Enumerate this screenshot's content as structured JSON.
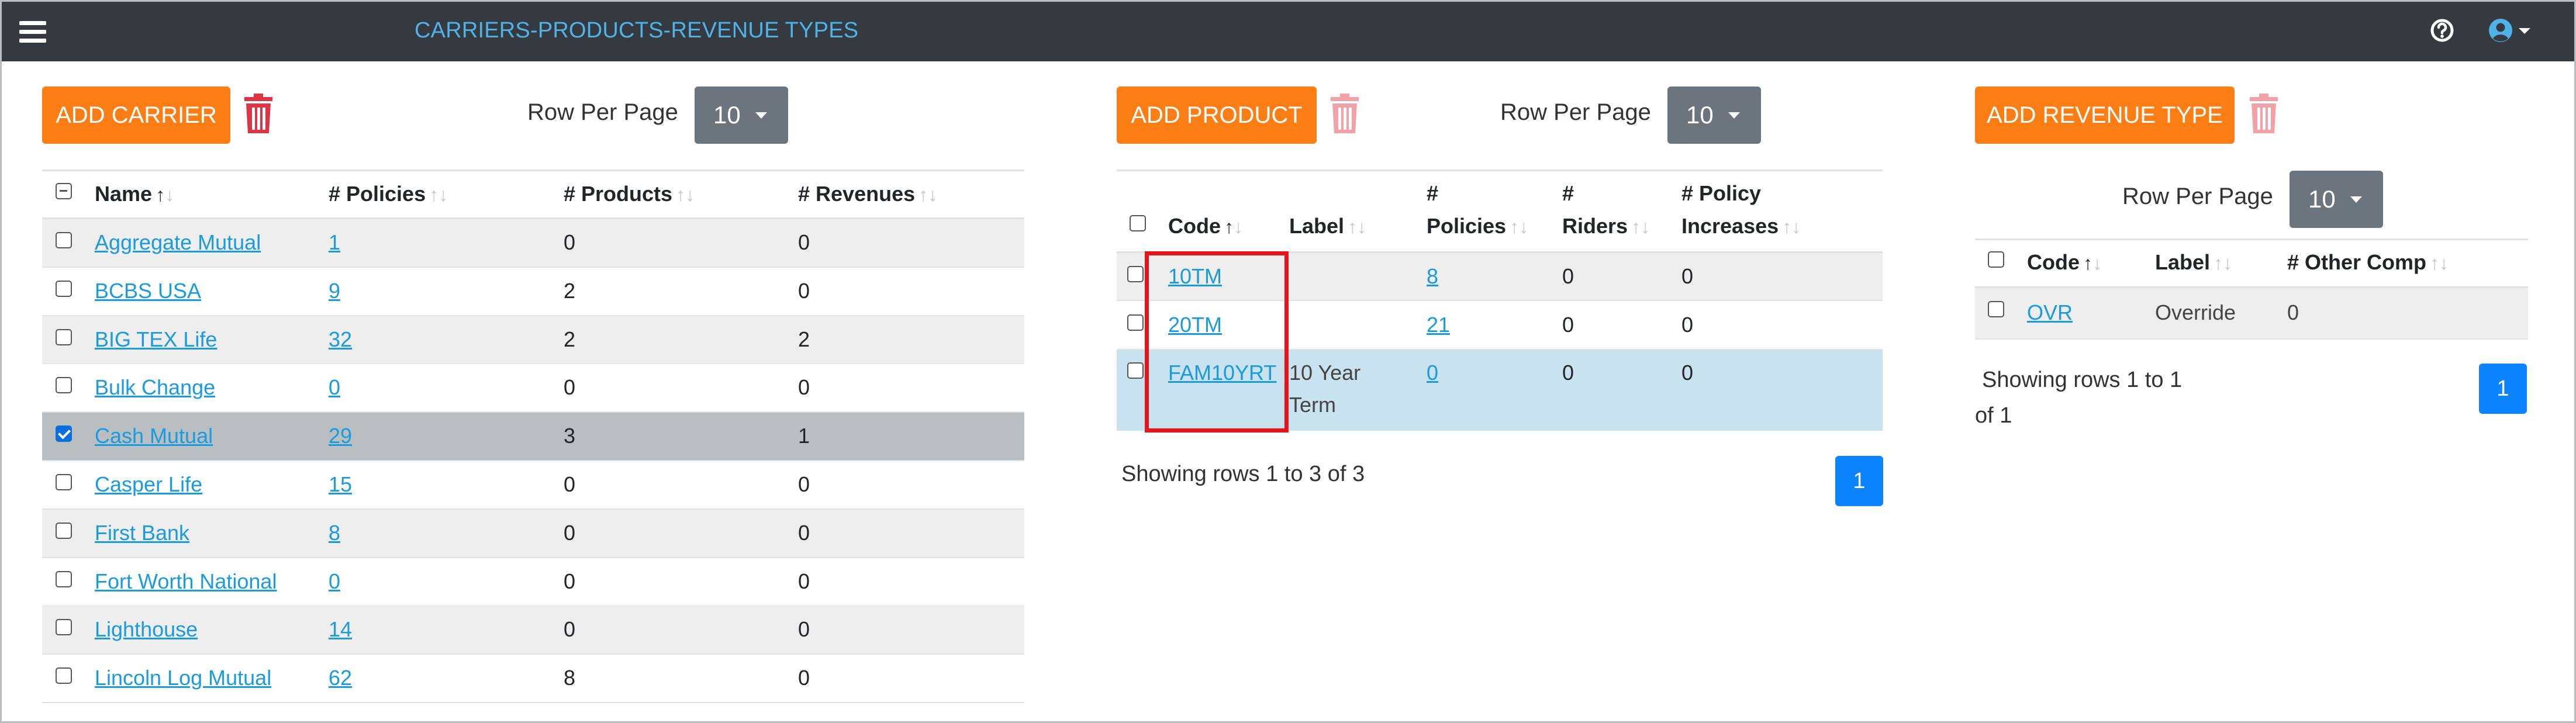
{
  "app": {
    "title": "CARRIERS-PRODUCTS-REVENUE TYPES"
  },
  "icons": {
    "menu": "hamburger-menu-icon",
    "help": "question-circle-icon",
    "user": "user-circle-icon",
    "delete": "trash-icon"
  },
  "colors": {
    "topbar": "#343a40",
    "title": "#4fb3e8",
    "accent": "#fd7e14",
    "link": "#1a9be0",
    "page_button": "#0d84ff",
    "selected_row": "#b9bec1",
    "highlight_row": "#c8e2ef",
    "annotation": "#e8141b"
  },
  "carriers": {
    "add_label": "ADD CARRIER",
    "rows_per_page_label": "Row Per Page",
    "rows_per_page_value": "10",
    "columns": [
      "Name",
      "# Policies",
      "# Products",
      "# Revenues"
    ],
    "rows": [
      {
        "name": "Aggregate Mutual",
        "policies": "1",
        "products": "0",
        "revenues": "0",
        "checked": false
      },
      {
        "name": "BCBS USA",
        "policies": "9",
        "products": "2",
        "revenues": "0",
        "checked": false
      },
      {
        "name": "BIG TEX Life",
        "policies": "32",
        "products": "2",
        "revenues": "2",
        "checked": false
      },
      {
        "name": "Bulk Change",
        "policies": "0",
        "products": "0",
        "revenues": "0",
        "checked": false
      },
      {
        "name": "Cash Mutual",
        "policies": "29",
        "products": "3",
        "revenues": "1",
        "checked": true
      },
      {
        "name": "Casper Life",
        "policies": "15",
        "products": "0",
        "revenues": "0",
        "checked": false
      },
      {
        "name": "First Bank",
        "policies": "8",
        "products": "0",
        "revenues": "0",
        "checked": false
      },
      {
        "name": "Fort Worth National",
        "policies": "0",
        "products": "0",
        "revenues": "0",
        "checked": false
      },
      {
        "name": "Lighthouse",
        "policies": "14",
        "products": "0",
        "revenues": "0",
        "checked": false
      },
      {
        "name": "Lincoln Log Mutual",
        "policies": "62",
        "products": "8",
        "revenues": "0",
        "checked": false
      }
    ]
  },
  "products": {
    "add_label": "ADD PRODUCT",
    "rows_per_page_label": "Row Per Page",
    "rows_per_page_value": "10",
    "columns": {
      "code": "Code",
      "label": "Label",
      "policies_1": "#",
      "policies_2": "Policies",
      "riders_1": "#",
      "riders_2": "Riders",
      "increases_1": "# Policy",
      "increases_2": "Increases"
    },
    "rows": [
      {
        "code": "10TM",
        "label": "",
        "policies": "8",
        "riders": "0",
        "increases": "0"
      },
      {
        "code": "20TM",
        "label": "",
        "policies": "21",
        "riders": "0",
        "increases": "0"
      },
      {
        "code": "FAM10YRT",
        "label_1": "10 Year",
        "label_2": "Term",
        "policies": "0",
        "riders": "0",
        "increases": "0"
      }
    ],
    "showing": "Showing rows 1 to 3 of 3",
    "page": "1"
  },
  "revenue_types": {
    "add_label": "ADD REVENUE TYPE",
    "rows_per_page_label": "Row Per Page",
    "rows_per_page_value": "10",
    "columns": [
      "Code",
      "Label",
      "# Other Comp"
    ],
    "rows": [
      {
        "code": "OVR",
        "label": "Override",
        "other_comp": "0"
      }
    ],
    "showing_1": "Showing rows 1 to 1",
    "showing_2": "of 1",
    "page": "1"
  }
}
